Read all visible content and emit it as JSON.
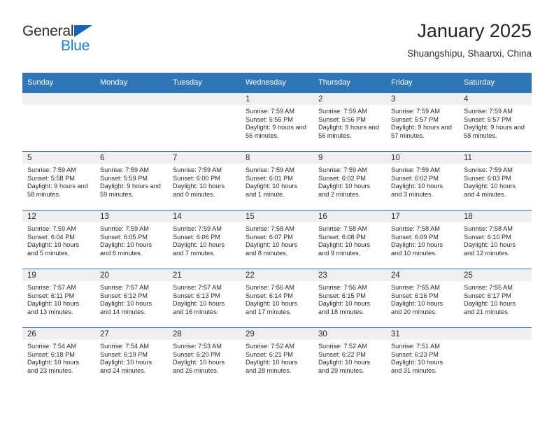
{
  "brand": {
    "line1": "General",
    "line2": "Blue",
    "triangle_color": "#1266b5",
    "blue_text_color": "#1b7fd4"
  },
  "header": {
    "title": "January 2025",
    "subtitle": "Shuangshipu, Shaanxi, China"
  },
  "theme": {
    "header_bar_color": "#2f76b8",
    "day_number_band_color": "#efefef",
    "row_divider_color": "#2f76b8",
    "text_color": "#2b2b2b"
  },
  "weekdays": [
    "Sunday",
    "Monday",
    "Tuesday",
    "Wednesday",
    "Thursday",
    "Friday",
    "Saturday"
  ],
  "labels": {
    "sunrise_prefix": "Sunrise:",
    "sunset_prefix": "Sunset:",
    "daylight_prefix": "Daylight:"
  },
  "weeks": [
    [
      {
        "day": "",
        "empty": true
      },
      {
        "day": "",
        "empty": true
      },
      {
        "day": "",
        "empty": true
      },
      {
        "day": "1",
        "sunrise": "Sunrise: 7:59 AM",
        "sunset": "Sunset: 5:55 PM",
        "daylight": "Daylight: 9 hours and 56 minutes."
      },
      {
        "day": "2",
        "sunrise": "Sunrise: 7:59 AM",
        "sunset": "Sunset: 5:56 PM",
        "daylight": "Daylight: 9 hours and 56 minutes."
      },
      {
        "day": "3",
        "sunrise": "Sunrise: 7:59 AM",
        "sunset": "Sunset: 5:57 PM",
        "daylight": "Daylight: 9 hours and 57 minutes."
      },
      {
        "day": "4",
        "sunrise": "Sunrise: 7:59 AM",
        "sunset": "Sunset: 5:57 PM",
        "daylight": "Daylight: 9 hours and 58 minutes."
      }
    ],
    [
      {
        "day": "5",
        "sunrise": "Sunrise: 7:59 AM",
        "sunset": "Sunset: 5:58 PM",
        "daylight": "Daylight: 9 hours and 58 minutes."
      },
      {
        "day": "6",
        "sunrise": "Sunrise: 7:59 AM",
        "sunset": "Sunset: 5:59 PM",
        "daylight": "Daylight: 9 hours and 59 minutes."
      },
      {
        "day": "7",
        "sunrise": "Sunrise: 7:59 AM",
        "sunset": "Sunset: 6:00 PM",
        "daylight": "Daylight: 10 hours and 0 minutes."
      },
      {
        "day": "8",
        "sunrise": "Sunrise: 7:59 AM",
        "sunset": "Sunset: 6:01 PM",
        "daylight": "Daylight: 10 hours and 1 minute."
      },
      {
        "day": "9",
        "sunrise": "Sunrise: 7:59 AM",
        "sunset": "Sunset: 6:02 PM",
        "daylight": "Daylight: 10 hours and 2 minutes."
      },
      {
        "day": "10",
        "sunrise": "Sunrise: 7:59 AM",
        "sunset": "Sunset: 6:02 PM",
        "daylight": "Daylight: 10 hours and 3 minutes."
      },
      {
        "day": "11",
        "sunrise": "Sunrise: 7:59 AM",
        "sunset": "Sunset: 6:03 PM",
        "daylight": "Daylight: 10 hours and 4 minutes."
      }
    ],
    [
      {
        "day": "12",
        "sunrise": "Sunrise: 7:59 AM",
        "sunset": "Sunset: 6:04 PM",
        "daylight": "Daylight: 10 hours and 5 minutes."
      },
      {
        "day": "13",
        "sunrise": "Sunrise: 7:59 AM",
        "sunset": "Sunset: 6:05 PM",
        "daylight": "Daylight: 10 hours and 6 minutes."
      },
      {
        "day": "14",
        "sunrise": "Sunrise: 7:59 AM",
        "sunset": "Sunset: 6:06 PM",
        "daylight": "Daylight: 10 hours and 7 minutes."
      },
      {
        "day": "15",
        "sunrise": "Sunrise: 7:58 AM",
        "sunset": "Sunset: 6:07 PM",
        "daylight": "Daylight: 10 hours and 8 minutes."
      },
      {
        "day": "16",
        "sunrise": "Sunrise: 7:58 AM",
        "sunset": "Sunset: 6:08 PM",
        "daylight": "Daylight: 10 hours and 9 minutes."
      },
      {
        "day": "17",
        "sunrise": "Sunrise: 7:58 AM",
        "sunset": "Sunset: 6:09 PM",
        "daylight": "Daylight: 10 hours and 10 minutes."
      },
      {
        "day": "18",
        "sunrise": "Sunrise: 7:58 AM",
        "sunset": "Sunset: 6:10 PM",
        "daylight": "Daylight: 10 hours and 12 minutes."
      }
    ],
    [
      {
        "day": "19",
        "sunrise": "Sunrise: 7:57 AM",
        "sunset": "Sunset: 6:11 PM",
        "daylight": "Daylight: 10 hours and 13 minutes."
      },
      {
        "day": "20",
        "sunrise": "Sunrise: 7:57 AM",
        "sunset": "Sunset: 6:12 PM",
        "daylight": "Daylight: 10 hours and 14 minutes."
      },
      {
        "day": "21",
        "sunrise": "Sunrise: 7:57 AM",
        "sunset": "Sunset: 6:13 PM",
        "daylight": "Daylight: 10 hours and 16 minutes."
      },
      {
        "day": "22",
        "sunrise": "Sunrise: 7:56 AM",
        "sunset": "Sunset: 6:14 PM",
        "daylight": "Daylight: 10 hours and 17 minutes."
      },
      {
        "day": "23",
        "sunrise": "Sunrise: 7:56 AM",
        "sunset": "Sunset: 6:15 PM",
        "daylight": "Daylight: 10 hours and 18 minutes."
      },
      {
        "day": "24",
        "sunrise": "Sunrise: 7:55 AM",
        "sunset": "Sunset: 6:16 PM",
        "daylight": "Daylight: 10 hours and 20 minutes."
      },
      {
        "day": "25",
        "sunrise": "Sunrise: 7:55 AM",
        "sunset": "Sunset: 6:17 PM",
        "daylight": "Daylight: 10 hours and 21 minutes."
      }
    ],
    [
      {
        "day": "26",
        "sunrise": "Sunrise: 7:54 AM",
        "sunset": "Sunset: 6:18 PM",
        "daylight": "Daylight: 10 hours and 23 minutes."
      },
      {
        "day": "27",
        "sunrise": "Sunrise: 7:54 AM",
        "sunset": "Sunset: 6:19 PM",
        "daylight": "Daylight: 10 hours and 24 minutes."
      },
      {
        "day": "28",
        "sunrise": "Sunrise: 7:53 AM",
        "sunset": "Sunset: 6:20 PM",
        "daylight": "Daylight: 10 hours and 26 minutes."
      },
      {
        "day": "29",
        "sunrise": "Sunrise: 7:52 AM",
        "sunset": "Sunset: 6:21 PM",
        "daylight": "Daylight: 10 hours and 28 minutes."
      },
      {
        "day": "30",
        "sunrise": "Sunrise: 7:52 AM",
        "sunset": "Sunset: 6:22 PM",
        "daylight": "Daylight: 10 hours and 29 minutes."
      },
      {
        "day": "31",
        "sunrise": "Sunrise: 7:51 AM",
        "sunset": "Sunset: 6:23 PM",
        "daylight": "Daylight: 10 hours and 31 minutes."
      },
      {
        "day": "",
        "empty": true
      }
    ]
  ]
}
